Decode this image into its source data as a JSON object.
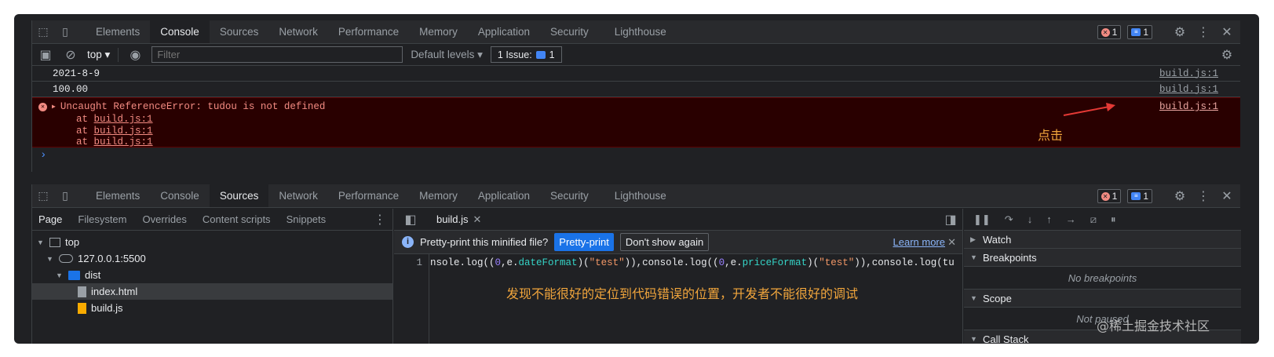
{
  "devtools_tabs": [
    "Elements",
    "Console",
    "Sources",
    "Network",
    "Performance",
    "Memory",
    "Application",
    "Security",
    "Lighthouse"
  ],
  "badges": {
    "errors": "1",
    "messages": "1"
  },
  "console_toolbar": {
    "context": "top",
    "filter_placeholder": "Filter",
    "levels": "Default levels",
    "issues_label": "1 Issue:",
    "issues_count": "1"
  },
  "console_lines": [
    {
      "text": "2021-8-9",
      "source": "build.js:1"
    },
    {
      "text": "100.00",
      "source": "build.js:1"
    }
  ],
  "error": {
    "message": "Uncaught ReferenceError: tudou is not defined",
    "source": "build.js:1",
    "stack_prefix": "at",
    "stack": [
      "build.js:1",
      "build.js:1",
      "build.js:1"
    ]
  },
  "annotation_click": "点击",
  "sources_subtabs": [
    "Page",
    "Filesystem",
    "Overrides",
    "Content scripts",
    "Snippets"
  ],
  "tree": {
    "top": "top",
    "host": "127.0.0.1:5500",
    "folder": "dist",
    "file1": "index.html",
    "file2": "build.js"
  },
  "editor": {
    "tab": "build.js",
    "info_text": "Pretty-print this minified file?",
    "pretty_print": "Pretty-print",
    "dont_show": "Don't show again",
    "learn_more": "Learn more",
    "line_number": "1",
    "code": {
      "p1": "nsole.log((",
      "n1": "0",
      "p2": ",e.",
      "f1": "dateFormat",
      "p3": ")(",
      "s1": "\"test\"",
      "p4": ")),console.log((",
      "n2": "0",
      "p5": ",e.",
      "f2": "priceFormat",
      "p6": ")(",
      "s2": "\"test\"",
      "p7": ")),console.log(tu"
    }
  },
  "annotation_locate": "发现不能很好的定位到代码错误的位置，开发者不能很好的调试",
  "debugger": {
    "watch": "Watch",
    "breakpoints": "Breakpoints",
    "no_breakpoints": "No breakpoints",
    "scope": "Scope",
    "not_paused": "Not paused",
    "call_stack": "Call Stack"
  },
  "watermark": "@稀土掘金技术社区"
}
